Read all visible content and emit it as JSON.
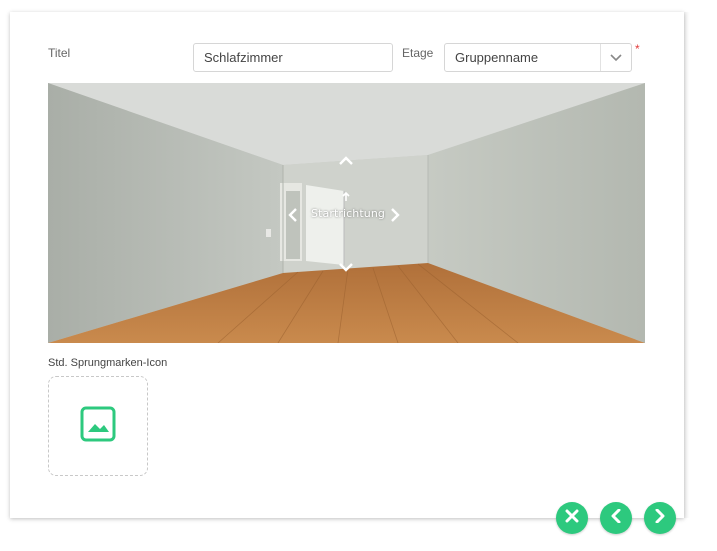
{
  "form": {
    "title_label": "Titel",
    "title_value": "Schlafzimmer",
    "floor_label": "Etage",
    "floor_value": "Gruppenname",
    "required_mark": "*"
  },
  "panorama": {
    "start_direction_label": "Startrichtung"
  },
  "icon_section": {
    "label": "Std. Sprungmarken-Icon"
  },
  "actions": {
    "cancel": "close-icon",
    "previous": "chevron-left-icon",
    "next": "chevron-right-icon"
  },
  "colors": {
    "accent": "#2dc97e",
    "required": "#e23b3b"
  }
}
